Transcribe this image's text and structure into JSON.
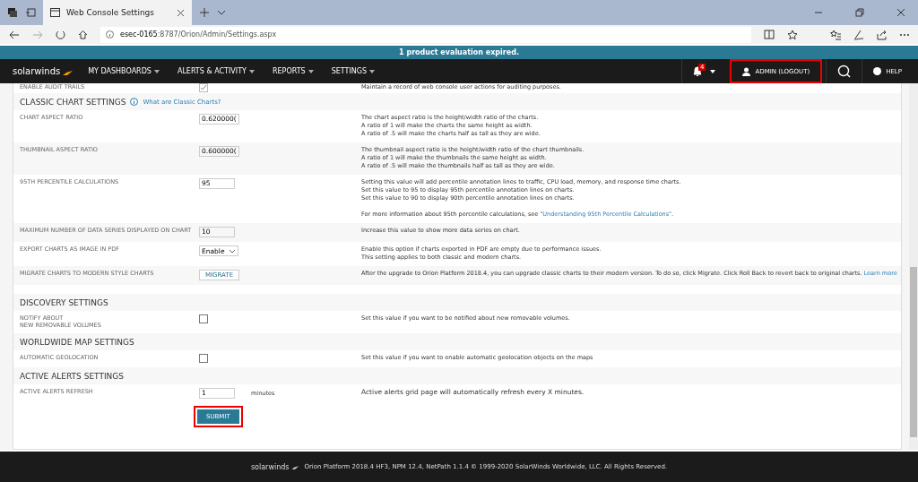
{
  "browser": {
    "tab_title": "Web Console Settings",
    "address_host": "esec-0165",
    "address_path": ":8787/Orion/Admin/Settings.aspx"
  },
  "banner": "1 product evaluation expired.",
  "nav": {
    "brand": "solarwinds",
    "menus": [
      "MY DASHBOARDS",
      "ALERTS & ACTIVITY",
      "REPORTS",
      "SETTINGS"
    ],
    "alert_count": "4",
    "user": {
      "label": "ADMIN (LOGOUT)",
      "highlighted": true
    },
    "help": "HELP"
  },
  "sections": [
    {
      "rows": [
        {
          "kind": "checkbox",
          "label": "ENABLE AUDIT TRAILS",
          "checked": true,
          "description": [
            {
              "text": "Maintain a record of web console user actions for auditing purposes."
            }
          ]
        }
      ]
    },
    {
      "title": "CLASSIC CHART SETTINGS",
      "link": "What are Classic Charts?",
      "rows": [
        {
          "kind": "text",
          "label": "CHART ASPECT RATIO",
          "value": "0.620000(",
          "description": [
            {
              "text": "The chart aspect ratio is the height/width ratio of the charts."
            },
            {
              "text": "A ratio of 1 will make the charts the same height as width."
            },
            {
              "text": "A ratio of .5 will make the charts half as tall as they are wide."
            }
          ]
        },
        {
          "kind": "text",
          "label": "THUMBNAIL ASPECT RATIO",
          "value": "0.600000(",
          "description": [
            {
              "text": "The thumbnail aspect ratio is the height/width ratio of the chart thumbnails."
            },
            {
              "text": "A ratio of 1 will make the thumbnails the same height as width."
            },
            {
              "text": "A ratio of .5 will make the thumbnails half as tall as they are wide."
            }
          ]
        },
        {
          "kind": "text",
          "label": "95TH PERCENTILE CALCULATIONS",
          "value": "95",
          "description": [
            {
              "text": "Setting this value will add percentile annotation lines to traffic, CPU load, memory, and response time charts."
            },
            {
              "text": "Set this value to 95 to display 95th percentile annotation lines on charts."
            },
            {
              "text": "Set this value to 90 to display 90th percentile annotation lines on charts."
            },
            {
              "gap": true,
              "text": "For more information about 95th percentile calculations, see ",
              "link": "\"Understanding 95th Percentile Calculations\"",
              "after": "."
            }
          ]
        },
        {
          "kind": "text",
          "label": "MAXIMUM NUMBER OF DATA SERIES DISPLAYED ON CHART",
          "value": "10",
          "description": [
            {
              "text": "Increase this value to show more data series on chart."
            }
          ]
        },
        {
          "kind": "select",
          "label": "EXPORT CHARTS AS IMAGE IN PDF",
          "value": "Enable",
          "description": [
            {
              "text": "Enable this option if charts exported in PDF are empty due to performance issues."
            },
            {
              "text": "This setting applies to both classic and modern charts."
            }
          ]
        },
        {
          "kind": "button",
          "label": "MIGRATE CHARTS TO MODERN STYLE CHARTS",
          "value": "MIGRATE",
          "description": [
            {
              "text": "After the upgrade to Orion Platform 2018.4, you can upgrade classic charts to their modern version. To do so, click Migrate. Click Roll Back to revert back to original charts. ",
              "link": "Learn more"
            }
          ]
        }
      ]
    },
    {
      "title": "DISCOVERY SETTINGS",
      "rows": [
        {
          "kind": "checkbox",
          "label": "NOTIFY ABOUT\nNEW REMOVABLE VOLUMES",
          "checked": false,
          "description": [
            {
              "text": "Set this value if you want to be notified about new removable volumes."
            }
          ]
        }
      ]
    },
    {
      "title": "WORLDWIDE MAP SETTINGS",
      "rows": [
        {
          "kind": "checkbox",
          "label": "AUTOMATIC GEOLOCATION",
          "checked": false,
          "description": [
            {
              "text": "Set this value if you want to enable automatic geolocation objects on the maps"
            }
          ]
        }
      ]
    },
    {
      "title": "ACTIVE ALERTS SETTINGS",
      "rows": [
        {
          "kind": "text",
          "label": "ACTIVE ALERTS REFRESH",
          "value": "1",
          "unit": "minutes",
          "description": [
            {
              "text": "Active alerts grid page will automatically refresh every X minutes.",
              "large": true
            }
          ]
        }
      ]
    }
  ],
  "submit": {
    "label": "SUBMIT",
    "highlighted": true
  },
  "footer": {
    "brand": "solarwinds",
    "text": "Orion Platform 2018.4 HF3, NPM 12.4, NetPath 1.1.4 © 1999-2020 SolarWinds Worldwide, LLC. All Rights Reserved."
  }
}
